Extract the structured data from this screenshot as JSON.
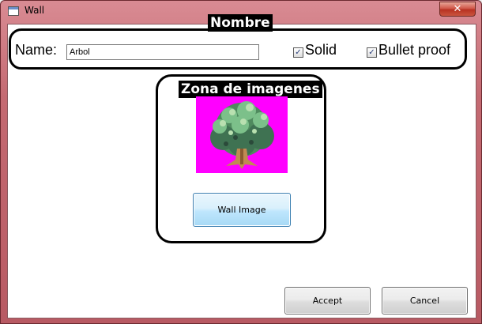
{
  "window": {
    "title": "Wall",
    "close_glyph": "✕",
    "icon": "app-window-icon"
  },
  "name_section": {
    "callout": "Nombre",
    "label": "Name:",
    "value": "Arbol",
    "solid": {
      "label": "Solid",
      "checked": true
    },
    "bullet_proof": {
      "label": "Bullet proof",
      "checked": true
    }
  },
  "image_section": {
    "callout": "Zona de imagenes",
    "preview_background": "#ff00ff",
    "preview_icon": "tree-sprite",
    "button_label": "Wall Image"
  },
  "footer": {
    "accept_label": "Accept",
    "cancel_label": "Cancel"
  },
  "colors": {
    "frame": "#c46a72",
    "close": "#c9553f",
    "highlight_button": "#bee6fd"
  }
}
